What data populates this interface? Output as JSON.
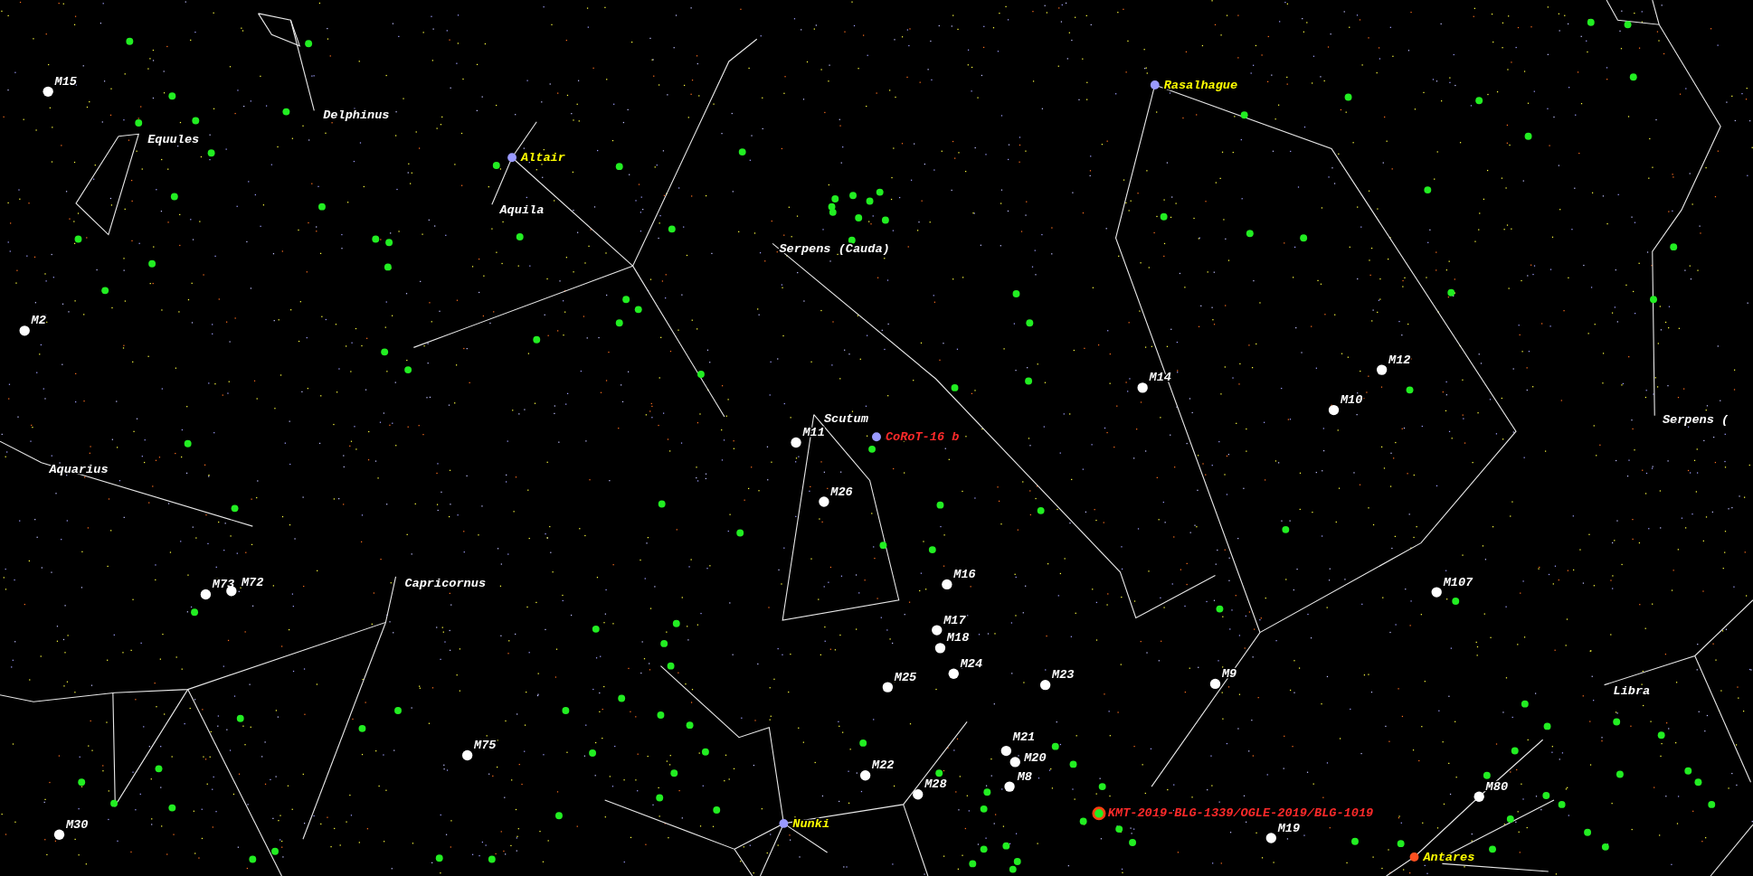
{
  "constellations": [
    {
      "label": "Delphinus"
    },
    {
      "label": "Equules"
    },
    {
      "label": "Aquila"
    },
    {
      "label": "Serpens (Cauda)"
    },
    {
      "label": "Scutum"
    },
    {
      "label": "Aquarius"
    },
    {
      "label": "Capricornus"
    },
    {
      "label": "Libra"
    },
    {
      "label": "Serpens ("
    }
  ],
  "messier": [
    {
      "label": "M15"
    },
    {
      "label": "M2"
    },
    {
      "label": "M73"
    },
    {
      "label": "M72"
    },
    {
      "label": "M30"
    },
    {
      "label": "M75"
    },
    {
      "label": "M11"
    },
    {
      "label": "M26"
    },
    {
      "label": "M16"
    },
    {
      "label": "M17"
    },
    {
      "label": "M18"
    },
    {
      "label": "M24"
    },
    {
      "label": "M25"
    },
    {
      "label": "M23"
    },
    {
      "label": "M21"
    },
    {
      "label": "M20"
    },
    {
      "label": "M8"
    },
    {
      "label": "M22"
    },
    {
      "label": "M28"
    },
    {
      "label": "M14"
    },
    {
      "label": "M12"
    },
    {
      "label": "M10"
    },
    {
      "label": "M9"
    },
    {
      "label": "M107"
    },
    {
      "label": "M19"
    },
    {
      "label": "M80"
    }
  ],
  "stars": [
    {
      "label": "Altair",
      "color": "#9a9aff"
    },
    {
      "label": "Rasalhague",
      "color": "#9a9aff"
    },
    {
      "label": "Nunki",
      "color": "#9a9aff"
    },
    {
      "label": "Antares",
      "color": "#ff5020"
    }
  ],
  "exoplanets": [
    {
      "label": "CoRoT-16 b",
      "kind": "dot"
    },
    {
      "label": "KMT-2019-BLG-1339/OGLE-2019/BLG-1019",
      "kind": "ring"
    }
  ]
}
